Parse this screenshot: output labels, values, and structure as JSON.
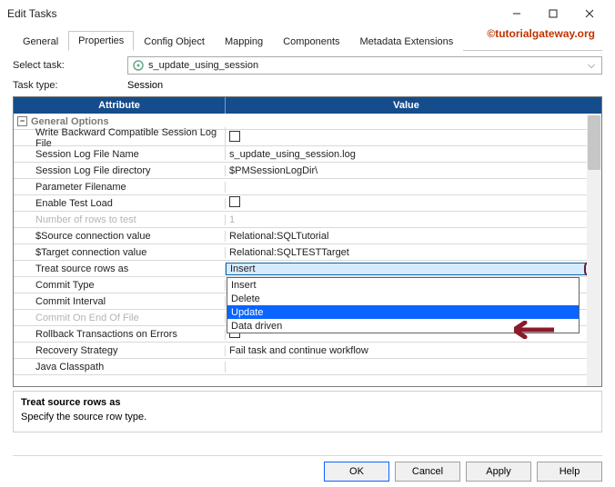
{
  "window": {
    "title": "Edit Tasks"
  },
  "branding": "©tutorialgateway.org",
  "tabs": [
    "General",
    "Properties",
    "Config Object",
    "Mapping",
    "Components",
    "Metadata Extensions"
  ],
  "active_tab": "Properties",
  "form": {
    "select_task_label": "Select task:",
    "select_task_value": "s_update_using_session",
    "task_type_label": "Task type:",
    "task_type_value": "Session"
  },
  "grid": {
    "headers": {
      "attribute": "Attribute",
      "value": "Value"
    },
    "section": "General Options",
    "rows": [
      {
        "attr": "Write Backward Compatible Session Log File",
        "type": "checkbox",
        "value": false
      },
      {
        "attr": "Session Log File Name",
        "type": "text",
        "value": "s_update_using_session.log"
      },
      {
        "attr": "Session Log File directory",
        "type": "text",
        "value": "$PMSessionLogDir\\"
      },
      {
        "attr": "Parameter Filename",
        "type": "text",
        "value": ""
      },
      {
        "attr": "Enable Test Load",
        "type": "checkbox",
        "value": false
      },
      {
        "attr": "Number of rows to test",
        "type": "text",
        "value": "1",
        "disabled": true
      },
      {
        "attr": "$Source connection value",
        "type": "text",
        "value": "Relational:SQLTutorial"
      },
      {
        "attr": "$Target connection value",
        "type": "text",
        "value": "Relational:SQLTESTTarget"
      },
      {
        "attr": "Treat source rows as",
        "type": "dropdown",
        "value": "Insert"
      },
      {
        "attr": "Commit Type",
        "type": "text",
        "value": ""
      },
      {
        "attr": "Commit Interval",
        "type": "text",
        "value": ""
      },
      {
        "attr": "Commit On End Of File",
        "type": "text",
        "value": "",
        "disabled": true
      },
      {
        "attr": "Rollback Transactions on Errors",
        "type": "checkbox",
        "value": false
      },
      {
        "attr": "Recovery Strategy",
        "type": "text",
        "value": "Fail task and continue workflow"
      },
      {
        "attr": "Java Classpath",
        "type": "text",
        "value": ""
      }
    ],
    "dropdown_options": [
      "Insert",
      "Delete",
      "Update",
      "Data driven"
    ],
    "dropdown_selected": "Update"
  },
  "description": {
    "title": "Treat source rows as",
    "text": "Specify the source row type."
  },
  "buttons": {
    "ok": "OK",
    "cancel": "Cancel",
    "apply": "Apply",
    "help": "Help"
  }
}
